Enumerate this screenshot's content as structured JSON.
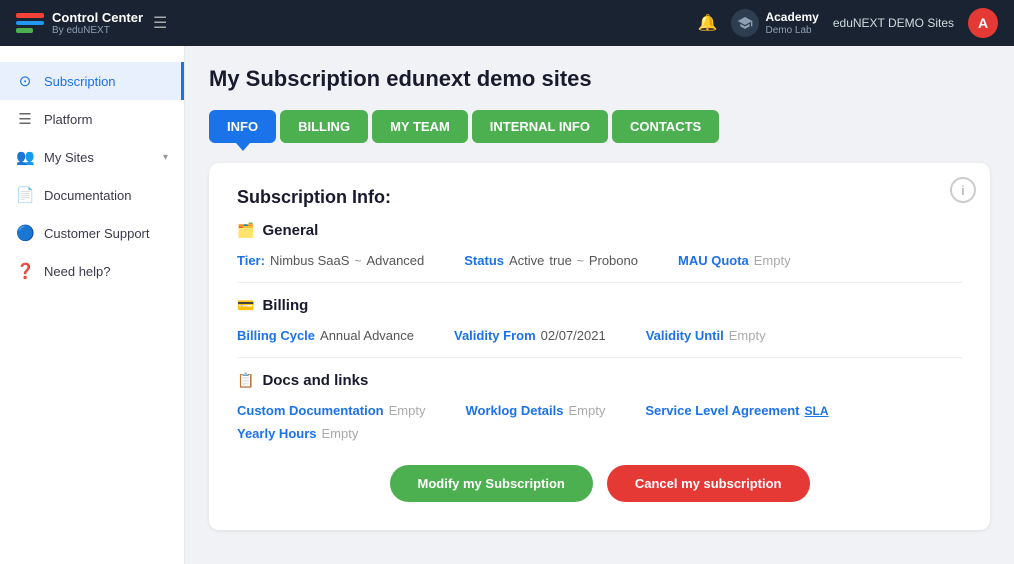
{
  "topnav": {
    "app_name": "Control Center",
    "app_sub": "By eduNEXT",
    "academy_name": "Academy",
    "academy_sub": "Demo Lab",
    "sites_label": "eduNEXT DEMO Sites",
    "avatar_letter": "A",
    "bell_icon": "🔔"
  },
  "sidebar": {
    "items": [
      {
        "id": "subscription",
        "label": "Subscription",
        "icon": "⊙",
        "active": true
      },
      {
        "id": "platform",
        "label": "Platform",
        "icon": "☰",
        "active": false
      },
      {
        "id": "mysites",
        "label": "My Sites",
        "icon": "👥",
        "active": false,
        "arrow": "▾"
      },
      {
        "id": "documentation",
        "label": "Documentation",
        "icon": "📄",
        "active": false
      },
      {
        "id": "customer-support",
        "label": "Customer Support",
        "icon": "🔵",
        "active": false
      },
      {
        "id": "need-help",
        "label": "Need help?",
        "icon": "❓",
        "active": false
      }
    ]
  },
  "main": {
    "page_title": "My Subscription edunext demo sites",
    "tabs": [
      {
        "id": "info",
        "label": "INFO",
        "active": true,
        "class": "active-tab"
      },
      {
        "id": "billing",
        "label": "BILLING",
        "active": false,
        "class": "billing-tab"
      },
      {
        "id": "myteam",
        "label": "MY TEAM",
        "active": false,
        "class": "myteam-tab"
      },
      {
        "id": "internal",
        "label": "INTERNAL INFO",
        "active": false,
        "class": "internal-tab"
      },
      {
        "id": "contacts",
        "label": "CONTACTS",
        "active": false,
        "class": "contacts-tab"
      }
    ],
    "card": {
      "section_title": "Subscription Info:",
      "general": {
        "title": "General",
        "tier_label": "Tier:",
        "tier_value": "Nimbus SaaS",
        "tier_dash": "~",
        "tier_advanced": "Advanced",
        "status_label": "Status",
        "status_active": "Active",
        "status_true": "true",
        "status_dash": "~",
        "status_probono": "Probono",
        "mau_label": "MAU Quota",
        "mau_value": "Empty"
      },
      "billing": {
        "title": "Billing",
        "cycle_label": "Billing Cycle",
        "cycle_value": "Annual Advance",
        "validity_from_label": "Validity From",
        "validity_from_value": "02/07/2021",
        "validity_until_label": "Validity Until",
        "validity_until_value": "Empty"
      },
      "docs": {
        "title": "Docs and links",
        "custom_doc_label": "Custom Documentation",
        "custom_doc_value": "Empty",
        "worklog_label": "Worklog Details",
        "worklog_value": "Empty",
        "sla_label": "Service Level Agreement",
        "sla_link": "SLA",
        "yearly_label": "Yearly Hours",
        "yearly_value": "Empty"
      },
      "modify_btn": "Modify my Subscription",
      "cancel_btn": "Cancel my subscription"
    }
  }
}
